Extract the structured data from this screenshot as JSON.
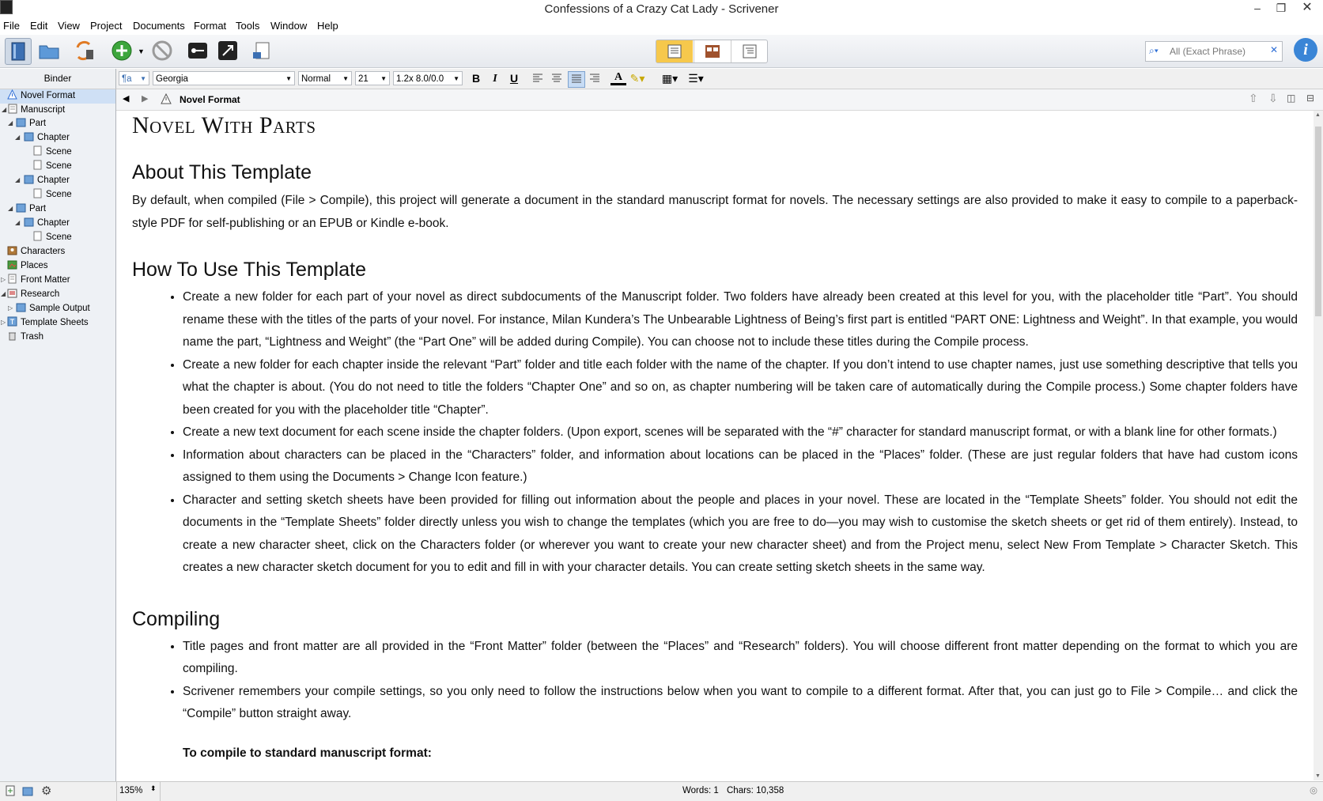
{
  "window": {
    "title": "Confessions of a Crazy Cat Lady - Scrivener"
  },
  "menu": [
    "File",
    "Edit",
    "View",
    "Project",
    "Documents",
    "Format",
    "Tools",
    "Window",
    "Help"
  ],
  "search": {
    "placeholder": "All (Exact Phrase)"
  },
  "format_bar": {
    "style_icon": "¶a",
    "font": "Georgia",
    "typeface": "Normal",
    "size": "21",
    "spacing": "1.2x 8.0/0.0",
    "bold": "B",
    "italic": "I",
    "underline": "U"
  },
  "binder": {
    "header": "Binder",
    "items": [
      {
        "label": "Novel Format",
        "icon": "warning-icon"
      },
      {
        "label": "Manuscript",
        "icon": "manuscript-icon"
      },
      {
        "label": "Part",
        "icon": "folder-icon"
      },
      {
        "label": "Chapter",
        "icon": "folder-icon"
      },
      {
        "label": "Scene",
        "icon": "document-icon"
      },
      {
        "label": "Scene",
        "icon": "document-icon"
      },
      {
        "label": "Chapter",
        "icon": "folder-icon"
      },
      {
        "label": "Scene",
        "icon": "document-icon"
      },
      {
        "label": "Part",
        "icon": "folder-icon"
      },
      {
        "label": "Chapter",
        "icon": "folder-icon"
      },
      {
        "label": "Scene",
        "icon": "document-icon"
      },
      {
        "label": "Characters",
        "icon": "characters-icon"
      },
      {
        "label": "Places",
        "icon": "places-icon"
      },
      {
        "label": "Front Matter",
        "icon": "front-matter-icon"
      },
      {
        "label": "Research",
        "icon": "research-icon"
      },
      {
        "label": "Sample Output",
        "icon": "folder-icon"
      },
      {
        "label": "Template Sheets",
        "icon": "template-icon"
      },
      {
        "label": "Trash",
        "icon": "trash-icon"
      }
    ]
  },
  "editor_header": {
    "doc_title": "Novel Format"
  },
  "document": {
    "title": "Novel With Parts",
    "about_heading": "About This Template",
    "about_text": "By default, when compiled (File > Compile), this project will generate a document in the standard manuscript format for novels. The necessary settings are also provided to make it easy to compile to a paperback-style PDF for self-publishing or an EPUB or Kindle e-book.",
    "howto_heading": "How To Use This Template",
    "howto_items": [
      "Create a new folder for each part of your novel as direct subdocuments of the Manuscript folder. Two  folders have already been created at this level for you, with the placeholder title “Part”. You should rename these with the titles of the parts of your novel. For instance, Milan Kundera’s The Unbearable Lightness of Being’s first part is entitled “PART ONE: Lightness and Weight”. In that example, you would name the part, “Lightness and Weight” (the “Part One” will be added during Compile). You can choose not to include these titles during the Compile process.",
      "Create a new folder for each chapter inside the relevant “Part” folder and title each folder with the name of the chapter. If you don’t intend to use chapter names, just use something descriptive that tells you what the chapter is about. (You do not need to title the folders “Chapter One” and so on, as chapter numbering will be taken care of automatically during the Compile process.) Some chapter folders have been created for you with the placeholder title “Chapter”.",
      "Create a new text document for each scene inside the chapter folders. (Upon export, scenes will be separated with the “#” character for standard manuscript format, or with a blank line for other formats.)",
      "Information about characters can be placed in the “Characters” folder, and information about locations can be placed in the “Places” folder. (These are just regular folders that have had custom icons assigned to them using the Documents > Change Icon feature.)",
      "Character and setting sketch sheets have been provided for filling out information about the people and places in your novel. These are located in the “Template Sheets” folder. You should not edit the documents in the “Template Sheets” folder directly unless you wish to change the templates (which you are free to do—you may wish to customise the sketch sheets or get rid of them entirely). Instead, to create a new character sheet, click on the Characters folder (or wherever you want to create your new character sheet) and from the Project menu, select New From Template > Character Sketch. This creates a new character sketch document for you to edit and fill in with your character details. You can create setting sketch sheets in the same way."
    ],
    "compiling_heading": "Compiling",
    "compiling_items": [
      "Title pages and front matter are all provided in the “Front Matter” folder (between the “Places” and “Research” folders). You will choose different front matter depending on the format to which you are compiling.",
      "Scrivener remembers your compile settings, so you only need to follow the instructions below when you want to compile to a different format. After that, you can just go to File > Compile… and click the “Compile” button straight away."
    ],
    "subheading": "To compile to standard manuscript format:"
  },
  "status": {
    "zoom": "135%",
    "words": "Words: 1",
    "chars": "Chars: 10,358"
  },
  "colors": {
    "accent": "#2f6fd6",
    "sidebar_bg": "#eef1f5",
    "toolbar_active": "#f6c84c"
  }
}
